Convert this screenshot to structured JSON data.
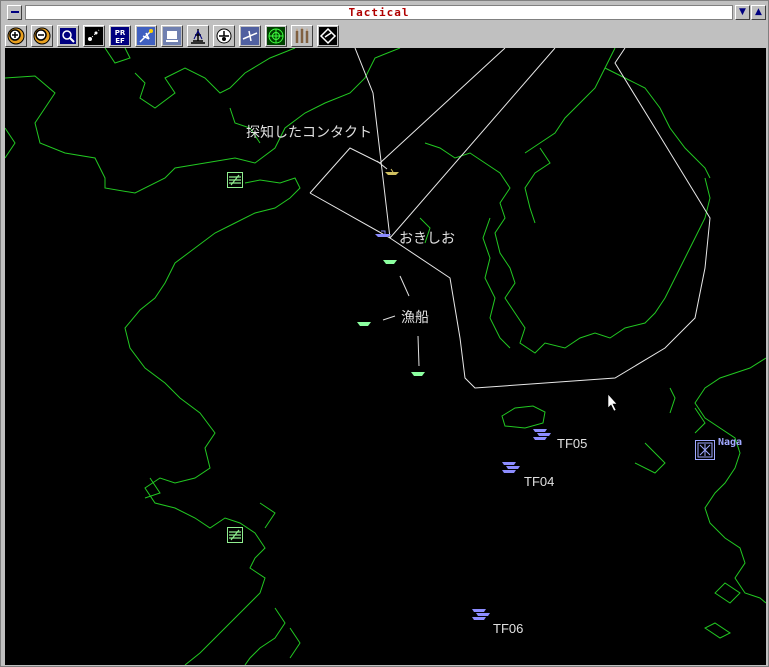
{
  "window": {
    "title": "Tactical"
  },
  "toolbar": {
    "tools": [
      {
        "icon": "zoom-in-icon"
      },
      {
        "icon": "zoom-out-icon"
      },
      {
        "icon": "zoom-fit-icon"
      },
      {
        "icon": "sensor-icon"
      },
      {
        "icon": "pref-icon",
        "text": "PR EF"
      },
      {
        "icon": "aircraft-icon"
      },
      {
        "icon": "helicopter-icon"
      },
      {
        "icon": "ship-icon"
      },
      {
        "icon": "submarine-icon"
      },
      {
        "icon": "jet-icon"
      },
      {
        "icon": "radar-icon"
      },
      {
        "icon": "missile-icon"
      },
      {
        "icon": "waypoint-icon"
      }
    ]
  },
  "map": {
    "labels": {
      "contact": "探知したコンタクト",
      "oki_shio": "おきしお",
      "fishing_boats": "漁船",
      "tf05": "TF05",
      "tf04": "TF04",
      "tf06": "TF06",
      "naga": "Naga"
    },
    "colors": {
      "coast": "#22c822",
      "friendly": "#8c8cff",
      "neutral": "#8cffa0",
      "boundary": "#e8e8e8",
      "base": "#90ee90"
    }
  }
}
